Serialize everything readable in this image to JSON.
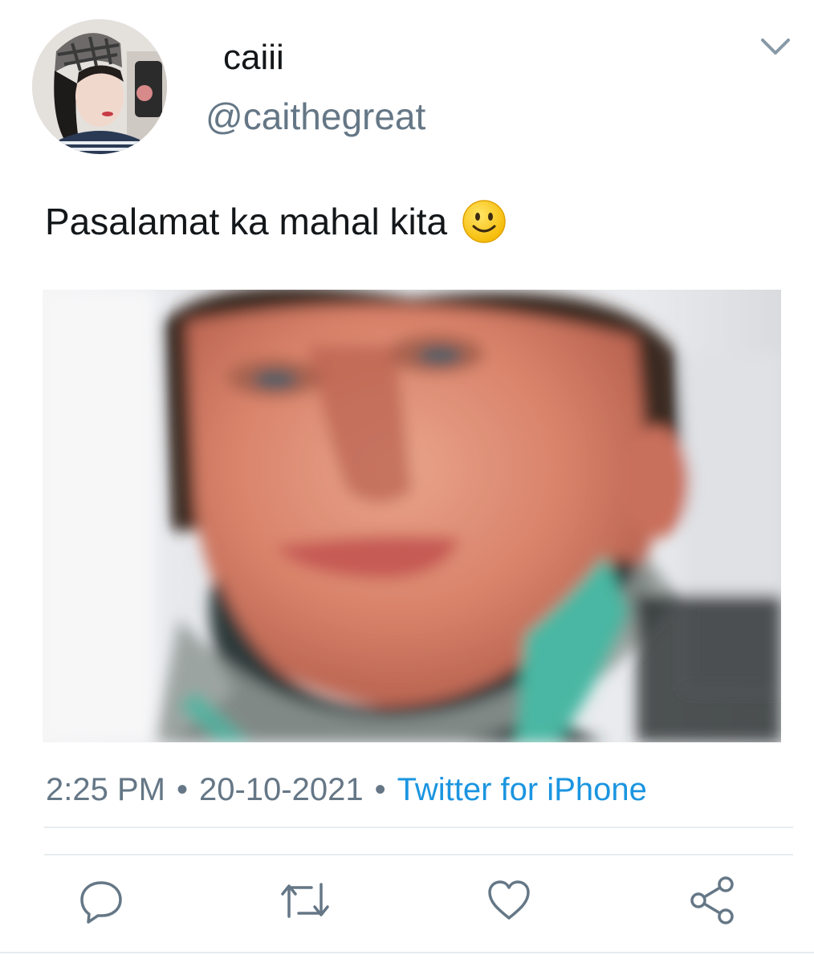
{
  "tweet": {
    "author": {
      "display_name": "caiii",
      "handle": "@caithegreat",
      "avatar_icon": "profile-photo"
    },
    "text": "Pasalamat ka mahal kita",
    "text_emoji": "slightly-smiling-face-emoji",
    "media": {
      "type": "photo",
      "description_icon": "attached-photo"
    },
    "time": "2:25 PM",
    "separator": "•",
    "date": "20-10-2021",
    "source": "Twitter for iPhone"
  },
  "actions": [
    {
      "name": "reply",
      "icon": "reply-icon"
    },
    {
      "name": "retweet",
      "icon": "retweet-icon"
    },
    {
      "name": "like",
      "icon": "heart-icon"
    },
    {
      "name": "share",
      "icon": "share-icon"
    }
  ],
  "colors": {
    "text_primary": "#14171a",
    "text_secondary": "#657786",
    "link": "#1b95e0",
    "icon": "#657786",
    "divider": "#e6ecf0"
  }
}
